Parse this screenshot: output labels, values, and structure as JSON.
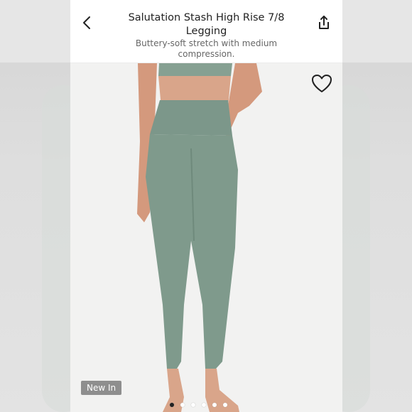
{
  "header": {
    "title": "Salutation Stash High Rise 7/8 Legging",
    "subtitle": "Buttery-soft stretch with medium compression."
  },
  "badge": {
    "label": "New In"
  },
  "carousel": {
    "total": 6,
    "active_index": 0
  },
  "icons": {
    "back": "chevron-left-icon",
    "share": "share-icon",
    "favorite": "heart-icon"
  },
  "colors": {
    "legging": "#7f9a8c",
    "skin": "#d9a58a",
    "badge": "#8e8e8e"
  }
}
